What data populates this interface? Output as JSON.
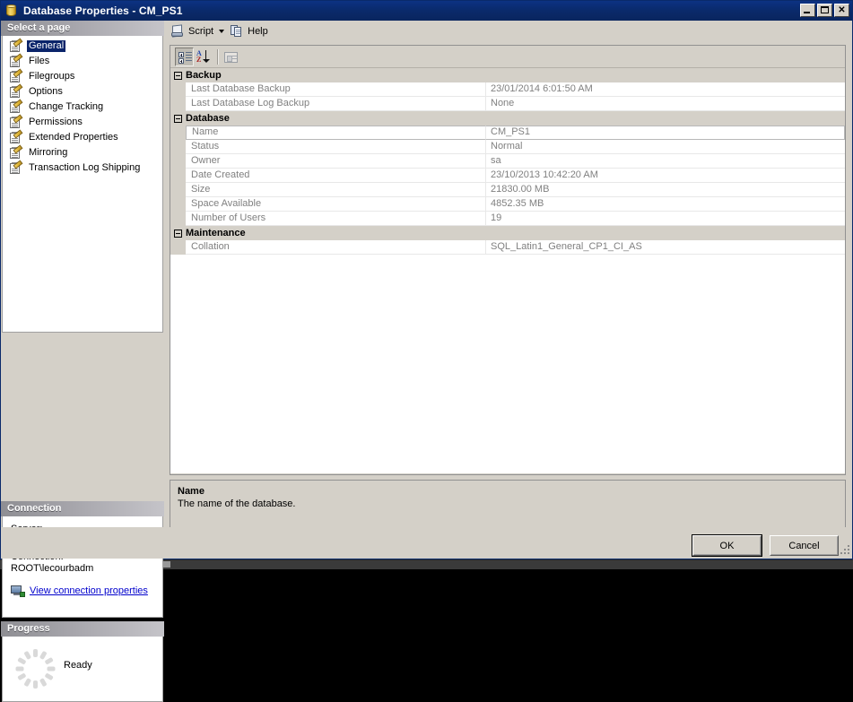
{
  "window": {
    "title": "Database Properties - CM_PS1",
    "icon": "database-icon",
    "buttons": {
      "minimize": "minimize-button",
      "maximize": "maximize-button",
      "close": "close-button"
    }
  },
  "sidebar": {
    "select_page_header": "Select a page",
    "items": [
      {
        "label": "General",
        "selected": true
      },
      {
        "label": "Files",
        "selected": false
      },
      {
        "label": "Filegroups",
        "selected": false
      },
      {
        "label": "Options",
        "selected": false
      },
      {
        "label": "Change Tracking",
        "selected": false
      },
      {
        "label": "Permissions",
        "selected": false
      },
      {
        "label": "Extended Properties",
        "selected": false
      },
      {
        "label": "Mirroring",
        "selected": false
      },
      {
        "label": "Transaction Log Shipping",
        "selected": false
      }
    ],
    "connection": {
      "header": "Connection",
      "server_label": "Server:",
      "server_value": "",
      "connection_label": "Connection:",
      "connection_value": "ROOT\\lecourbadm",
      "view_properties_link": "View connection properties"
    },
    "progress": {
      "header": "Progress",
      "status": "Ready"
    }
  },
  "toolbar": {
    "script_label": "Script",
    "help_label": "Help"
  },
  "grid_toolbar": {
    "categorized_tooltip": "Categorized",
    "alphabetical_tooltip": "Alphabetical",
    "pages_tooltip": "Property Pages"
  },
  "grid": {
    "rows": [
      {
        "kind": "category",
        "name": "Backup",
        "expanded": true
      },
      {
        "kind": "property",
        "name": "Last Database Backup",
        "value": "23/01/2014 6:01:50 AM",
        "selected": false
      },
      {
        "kind": "property",
        "name": "Last Database Log Backup",
        "value": "None",
        "selected": false
      },
      {
        "kind": "category",
        "name": "Database",
        "expanded": true
      },
      {
        "kind": "property",
        "name": "Name",
        "value": "CM_PS1",
        "selected": true
      },
      {
        "kind": "property",
        "name": "Status",
        "value": "Normal",
        "selected": false
      },
      {
        "kind": "property",
        "name": "Owner",
        "value": "sa",
        "selected": false
      },
      {
        "kind": "property",
        "name": "Date Created",
        "value": "23/10/2013 10:42:20 AM",
        "selected": false
      },
      {
        "kind": "property",
        "name": "Size",
        "value": "21830.00 MB",
        "selected": false
      },
      {
        "kind": "property",
        "name": "Space Available",
        "value": "4852.35 MB",
        "selected": false
      },
      {
        "kind": "property",
        "name": "Number of Users",
        "value": "19",
        "selected": false
      },
      {
        "kind": "category",
        "name": "Maintenance",
        "expanded": true
      },
      {
        "kind": "property",
        "name": "Collation",
        "value": "SQL_Latin1_General_CP1_CI_AS",
        "selected": false
      }
    ]
  },
  "description": {
    "title": "Name",
    "text": "The name of the database."
  },
  "footer": {
    "ok_label": "OK",
    "cancel_label": "Cancel"
  },
  "colors": {
    "titlebar": "#0a2a6b",
    "dialog_face": "#d4d0c8",
    "selection": "#0a246a",
    "link": "#0000cc",
    "grid_text": "#808080",
    "pane_header_start": "#8e8e93",
    "pane_header_end": "#c5c4c9"
  }
}
